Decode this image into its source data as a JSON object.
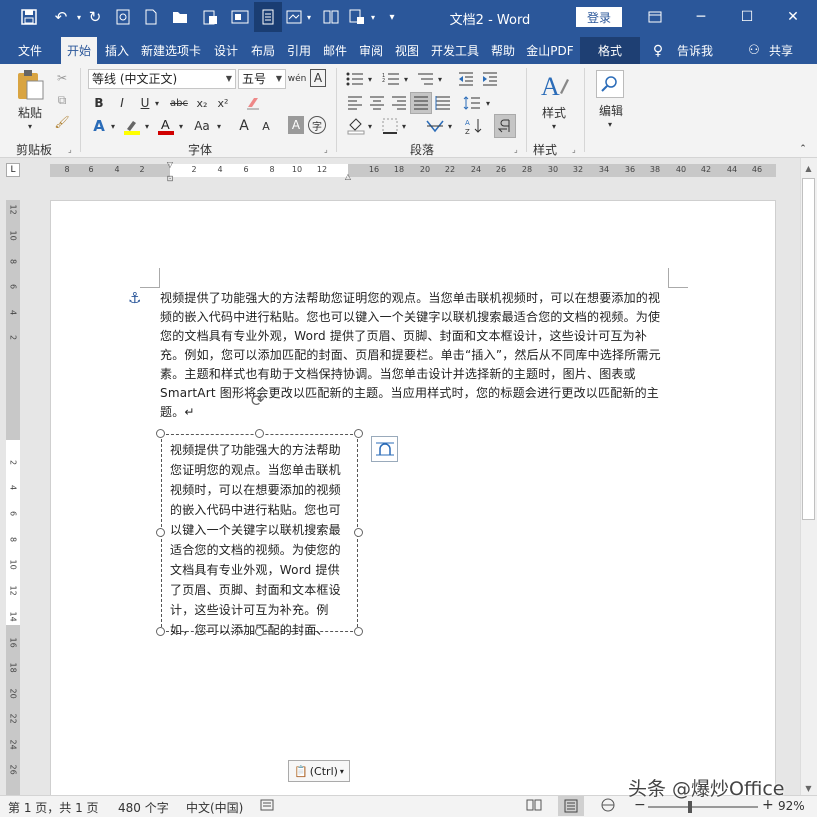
{
  "title_bar": {
    "doc_title": "文档2 - Word",
    "login_label": "登录",
    "icons": [
      "save-icon",
      "undo-icon",
      "redo-icon",
      "print-preview-icon",
      "new-doc-icon",
      "open-icon",
      "paste-icon",
      "screenshot-icon",
      "read-mode-icon",
      "shape-icon",
      "compare-icon",
      "quick-access-icon"
    ],
    "window_controls": [
      "ribbon-display-icon",
      "minimize-icon",
      "maximize-icon",
      "close-icon"
    ]
  },
  "tabs": [
    {
      "label": "文件"
    },
    {
      "label": "开始"
    },
    {
      "label": "插入"
    },
    {
      "label": "新建选项卡"
    },
    {
      "label": "设计"
    },
    {
      "label": "布局"
    },
    {
      "label": "引用"
    },
    {
      "label": "邮件"
    },
    {
      "label": "审阅"
    },
    {
      "label": "视图"
    },
    {
      "label": "开发工具"
    },
    {
      "label": "帮助"
    },
    {
      "label": "金山PDF"
    },
    {
      "label": "格式"
    }
  ],
  "tell_me": "告诉我",
  "share": "共享",
  "ribbon": {
    "clipboard": {
      "label": "剪贴板",
      "paste": "粘贴"
    },
    "font": {
      "label": "字体",
      "font_name": "等线 (中文正文)",
      "font_size": "五号",
      "buttons": {
        "bold": "B",
        "italic": "I",
        "underline": "U",
        "strike": "abc",
        "sub": "x₂",
        "sup": "x²",
        "case": "Aa",
        "grow": "A",
        "shrink": "A",
        "wen": "wén",
        "border": "A",
        "shade": "A",
        "circle": "字"
      }
    },
    "paragraph": {
      "label": "段落"
    },
    "styles": {
      "label": "样式",
      "button": "样式"
    },
    "editing": {
      "button": "编辑"
    }
  },
  "ruler": {
    "h_ticks": [
      "8",
      "6",
      "4",
      "2",
      "2",
      "4",
      "6",
      "8",
      "10",
      "12",
      "16",
      "18",
      "20",
      "22",
      "24",
      "26",
      "28",
      "30",
      "32",
      "34",
      "36",
      "38",
      "40",
      "42",
      "44",
      "46"
    ],
    "v_ticks": [
      "12",
      "10",
      "8",
      "6",
      "4",
      "2",
      "2",
      "4",
      "6",
      "8",
      "10",
      "12",
      "14",
      "16",
      "18",
      "20",
      "22",
      "24",
      "26",
      "28"
    ]
  },
  "document": {
    "paragraph": "视频提供了功能强大的方法帮助您证明您的观点。当您单击联机视频时，可以在想要添加的视频的嵌入代码中进行粘贴。您也可以键入一个关键字以联机搜索最适合您的文档的视频。为使您的文档具有专业外观，Word 提供了页眉、页脚、封面和文本框设计，这些设计可互为补充。例如，您可以添加匹配的封面、页眉和提要栏。单击“插入”，然后从不同库中选择所需元素。主题和样式也有助于文档保持协调。当您单击设计并选择新的主题时，图片、图表或 SmartArt 图形将会更改以匹配新的主题。当应用样式时，您的标题会进行更改以匹配新的主题。↵",
    "textbox": "视频提供了功能强大的方法帮助您证明您的观点。当您单击联机视频时，可以在想要添加的视频的嵌入代码中进行粘贴。您也可以键入一个关键字以联机搜索最适合您的文档的视频。为使您的文档具有专业外观，Word 提供了页眉、页脚、封面和文本框设计，这些设计可互为补充。例如，您可以添加匹配的封面、",
    "paste_options": "(Ctrl)"
  },
  "status": {
    "page": "第 1 页，共 1 页",
    "words": "480 个字",
    "lang": "中文(中国)",
    "zoom": "92%",
    "zoom_minus": "−",
    "zoom_plus": "+"
  },
  "watermark": "头条 @爆炒Office",
  "colors": {
    "brand": "#2b579a",
    "ribbon": "#f3f3f3",
    "format_tab": "#1e3f73"
  }
}
